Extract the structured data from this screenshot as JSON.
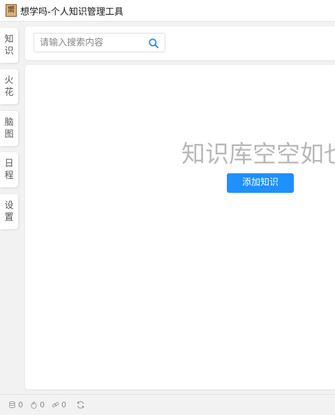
{
  "app": {
    "icon_glyph": "嚮",
    "title": "想学吗-个人知识管理工具"
  },
  "sidebar": {
    "items": [
      {
        "line1": "知",
        "line2": "识"
      },
      {
        "line1": "火",
        "line2": "花"
      },
      {
        "line1": "脑",
        "line2": "图"
      },
      {
        "line1": "日",
        "line2": "程"
      },
      {
        "line1": "设",
        "line2": "置"
      }
    ]
  },
  "search": {
    "placeholder": "请输入搜索内容",
    "value": "",
    "icon": "search-icon"
  },
  "main": {
    "empty_text": "知识库空空如也",
    "add_button_label": "添加知识"
  },
  "status": {
    "items": [
      {
        "icon": "database-icon",
        "count": "0"
      },
      {
        "icon": "fire-icon",
        "count": "0"
      },
      {
        "icon": "link-icon",
        "count": "0"
      }
    ],
    "refresh_icon": "refresh-icon"
  },
  "colors": {
    "accent": "#1e90ff",
    "empty_text": "#b8b8b8",
    "background": "#f2f2f2"
  }
}
